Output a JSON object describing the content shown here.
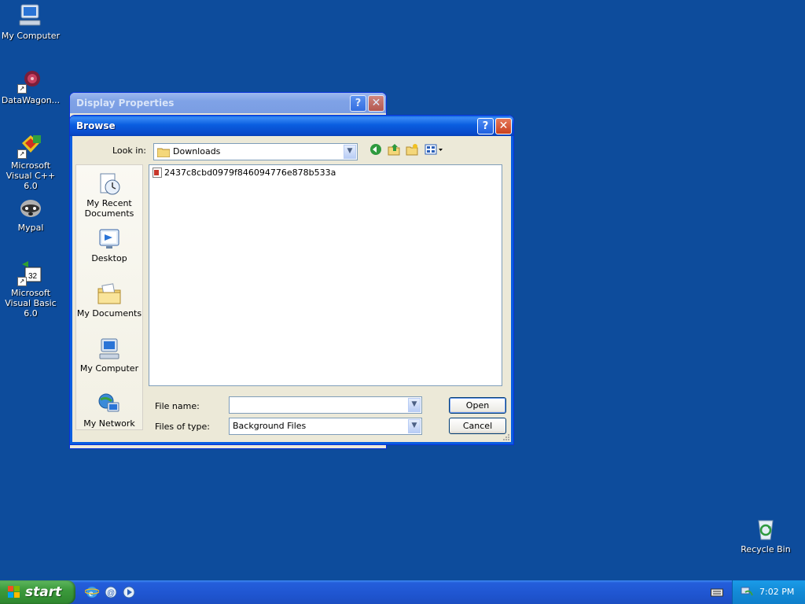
{
  "desktop": {
    "icons": [
      {
        "label": "My Computer"
      },
      {
        "label": "DataWagon..."
      },
      {
        "label": "Microsoft Visual C++ 6.0"
      },
      {
        "label": "Mypal"
      },
      {
        "label": "Microsoft Visual Basic 6.0"
      },
      {
        "label": "Recycle Bin"
      }
    ]
  },
  "display_properties": {
    "title": "Display Properties",
    "help_glyph": "?",
    "close_glyph": "✕"
  },
  "browse": {
    "title": "Browse",
    "help_glyph": "?",
    "close_glyph": "✕",
    "look_in_label": "Look in:",
    "look_in_value": "Downloads",
    "places": [
      {
        "label": "My Recent Documents"
      },
      {
        "label": "Desktop"
      },
      {
        "label": "My Documents"
      },
      {
        "label": "My Computer"
      },
      {
        "label": "My Network"
      }
    ],
    "files": [
      {
        "name": "2437c8cbd0979f846094776e878b533a"
      }
    ],
    "file_name_label": "File name:",
    "file_name_value": "",
    "files_of_type_label": "Files of type:",
    "files_of_type_value": "Background Files",
    "open_label": "Open",
    "cancel_label": "Cancel"
  },
  "taskbar": {
    "start_label": "start",
    "clock": "7:02 PM"
  },
  "colors": {
    "desktop": "#0D4C9C",
    "titlebar": "#0A5EE0",
    "start_green": "#3C9A3C"
  }
}
